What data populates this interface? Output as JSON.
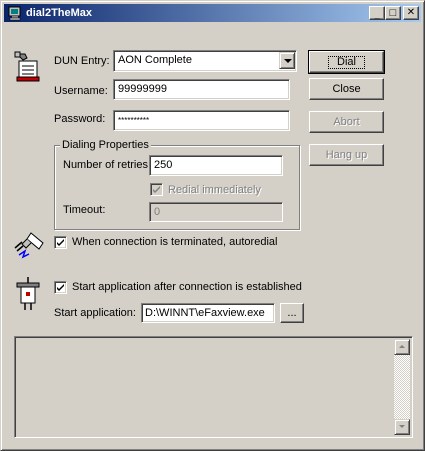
{
  "window": {
    "title": "dial2TheMax"
  },
  "titlebar": {
    "minimize_glyph": "_",
    "maximize_glyph": "□",
    "close_glyph": "✕"
  },
  "dun": {
    "label": "DUN Entry:",
    "selected": "AON Complete"
  },
  "username": {
    "label": "Username:",
    "value": "99999999"
  },
  "password": {
    "label": "Password:",
    "value": "**********"
  },
  "buttons": {
    "dial": "Dial",
    "close": "Close",
    "abort": "Abort",
    "hangup": "Hang up",
    "browse": "..."
  },
  "dialing": {
    "title": "Dialing Properties",
    "retries_label": "Number of retries:",
    "retries_value": "250",
    "redial_label": "Redial immediately",
    "redial_checked": true,
    "timeout_label": "Timeout:",
    "timeout_value": "0"
  },
  "autoredial": {
    "label": "When connection is terminated, autoredial",
    "checked": true
  },
  "startapp": {
    "checkbox_label": "Start application after connection is established",
    "checked": true,
    "field_label": "Start application:",
    "field_value": "D:\\WINNT\\eFaxview.exe"
  },
  "icons": {
    "title": "dial-app-icon",
    "dun": "phone-book-icon",
    "redial": "plug-spark-icon",
    "app": "power-plug-icon"
  },
  "colors": {
    "titlebar_start": "#0a246a",
    "titlebar_end": "#a6caf0",
    "face": "#d4d0c8"
  }
}
